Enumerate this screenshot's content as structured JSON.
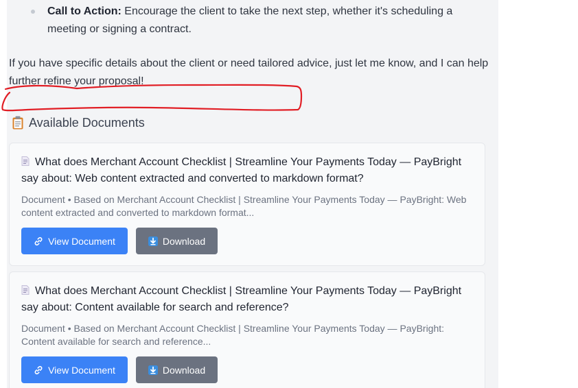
{
  "message": {
    "bullet": {
      "label": "Call to Action:",
      "text": " Encourage the client to take the next step, whether it's scheduling a meeting or signing a contract."
    },
    "closing": "If you have specific details about the client or need tailored advice, just let me know, and I can help further refine your proposal!"
  },
  "documents_section": {
    "title": "Available Documents",
    "icon": "clipboard-icon",
    "cards": [
      {
        "icon": "document-icon",
        "title": "What does Merchant Account Checklist | Streamline Your Payments Today — PayBright say about: Web content extracted and converted to markdown format?",
        "meta": "Document • Based on Merchant Account Checklist | Streamline Your Payments Today — PayBright: Web content extracted and converted to markdown format...",
        "view_label": "View Document",
        "download_label": "Download"
      },
      {
        "icon": "document-icon",
        "title": "What does Merchant Account Checklist | Streamline Your Payments Today — PayBright say about: Content available for search and reference?",
        "meta": "Document • Based on Merchant Account Checklist | Streamline Your Payments Today — PayBright: Content available for search and reference...",
        "view_label": "View Document",
        "download_label": "Download"
      }
    ]
  },
  "colors": {
    "panel_bg": "#f3f4f6",
    "view_button": "#3b82f6",
    "download_button": "#6b7280",
    "annotation": "#e11d24"
  }
}
